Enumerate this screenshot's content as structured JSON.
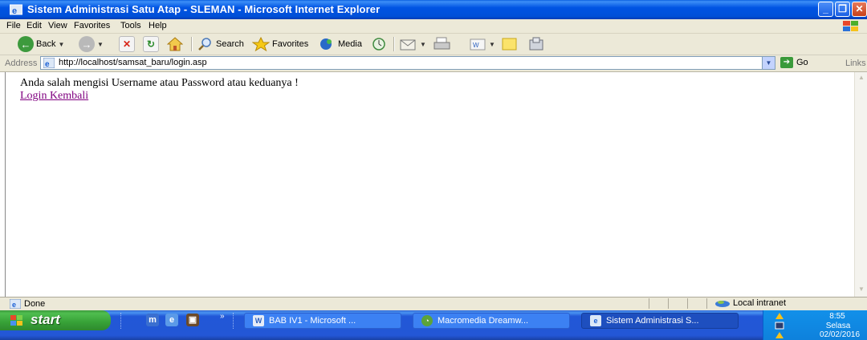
{
  "window": {
    "title": "Sistem Administrasi Satu Atap - SLEMAN - Microsoft Internet Explorer"
  },
  "menu": [
    "File",
    "Edit",
    "View",
    "Favorites",
    "Tools",
    "Help"
  ],
  "toolbar": {
    "back": "Back",
    "search": "Search",
    "favorites": "Favorites",
    "media": "Media"
  },
  "address": {
    "label": "Address",
    "url": "http://localhost/samsat_baru/login.asp",
    "go": "Go",
    "links": "Links"
  },
  "page": {
    "message": "Anda salah mengisi Username atau Password atau keduanya !",
    "link": "Login Kembali"
  },
  "status": {
    "text": "Done",
    "zone": "Local intranet"
  },
  "taskbar": {
    "start": "start",
    "tasks": [
      {
        "label": "BAB IV1 - Microsoft ..."
      },
      {
        "label": "Macromedia Dreamw..."
      },
      {
        "label": "Sistem Administrasi S..."
      }
    ],
    "clock": "8:55",
    "day": "Selasa",
    "date": "02/02/2016"
  },
  "colors": {
    "titlebar": "#0054e3",
    "visited_link": "#800080",
    "taskbar": "#2357d6",
    "start_button": "#37a137"
  }
}
